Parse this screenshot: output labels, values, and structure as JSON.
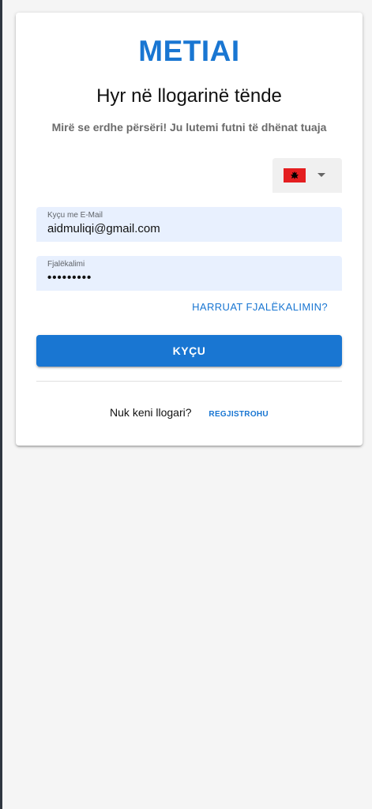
{
  "app": {
    "logo_text": "METIAI",
    "accent_color": "#1976d2"
  },
  "login": {
    "title": "Hyr në llogarinë tënde",
    "subtitle": "Mirë se erdhe përsëri! Ju lutemi futni të dhënat tuaja",
    "language": {
      "selected_flag_icon": "albania-flag-icon",
      "dropdown_icon": "caret-down-icon"
    },
    "email": {
      "label": "Kyçu me E-Mail",
      "value": "aidmuliqi@gmail.com"
    },
    "password": {
      "label": "Fjalëkalimi",
      "value": "•••••••••"
    },
    "forgot_label": "HARRUAT FJALËKALIMIN?",
    "login_label": "KYÇU",
    "no_account_text": "Nuk keni llogari?",
    "register_label": "REGJISTROHU"
  }
}
